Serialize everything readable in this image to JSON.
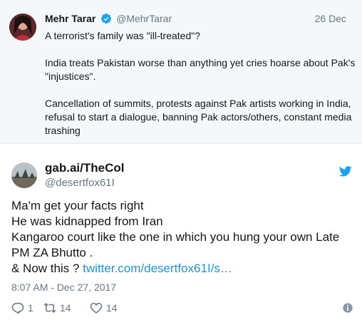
{
  "quoted_tweet": {
    "author_name": "Mehr Tarar",
    "handle": "@MehrTarar",
    "date": "26 Dec",
    "paragraphs": [
      "A terrorist's family was \"ill-treated\"?",
      "India treats Pakistan worse than anything yet cries hoarse about Pak's \"injustices\".",
      "Cancellation of summits, protests against Pak artists working in India, refusal to start a dialogue, banning Pak actors/others, constant media trashing"
    ]
  },
  "reply_tweet": {
    "author_name": "gab.ai/TheCol",
    "handle": "@desertfox61I",
    "lines": [
      "Ma'm get your facts right",
      "He was kidnapped from Iran",
      "Kangaroo court like the one in which you hung your own Late PM ZA Bhutto .",
      "& Now this ?"
    ],
    "link_text": "twitter.com/desertfox61I/s…",
    "timestamp": "8:07 AM - Dec 27, 2017",
    "actions": {
      "reply_count": "1",
      "retweet_count": "14",
      "like_count": "14"
    }
  },
  "colors": {
    "link": "#1b95e0",
    "secondary_text": "#657786",
    "quoted_background": "#f5f8fa",
    "twitter_blue": "#1da1f2"
  },
  "icons": [
    "verified-badge-icon",
    "twitter-bird-icon",
    "reply-icon",
    "retweet-icon",
    "like-heart-icon",
    "info-icon"
  ]
}
